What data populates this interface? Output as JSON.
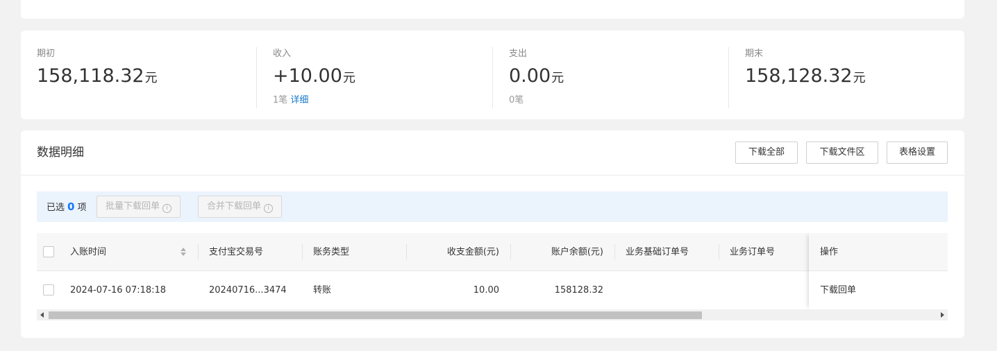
{
  "summary": {
    "opening": {
      "label": "期初",
      "value": "158,118.32",
      "unit": "元"
    },
    "income": {
      "label": "收入",
      "value": "+10.00",
      "unit": "元",
      "count": "1笔",
      "detail_link": "详细"
    },
    "expense": {
      "label": "支出",
      "value": "0.00",
      "unit": "元",
      "count": "0笔"
    },
    "closing": {
      "label": "期末",
      "value": "158,128.32",
      "unit": "元"
    }
  },
  "detail": {
    "title": "数据明细",
    "buttons": {
      "download_all": "下载全部",
      "download_files": "下载文件区",
      "table_settings": "表格设置"
    },
    "selection": {
      "prefix": "已选",
      "count": "0",
      "suffix": "项",
      "batch_download": "批量下载回单",
      "merge_download": "合并下载回单"
    },
    "columns": [
      "入账时间",
      "支付宝交易号",
      "账务类型",
      "收支金额(元)",
      "账户余额(元)",
      "业务基础订单号",
      "业务订单号",
      "操作"
    ],
    "rows": [
      {
        "time": "2024-07-16 07:18:18",
        "trade_no": "20240716...3474",
        "type": "转账",
        "amount": "10.00",
        "balance": "158128.32",
        "base_order": "",
        "order": "",
        "action": "下载回单"
      }
    ]
  },
  "colors": {
    "link": "#1677c8",
    "accent_count": "#1677ff",
    "selection_bg": "#ebf3fd",
    "page_bg": "#f2f2f2"
  }
}
